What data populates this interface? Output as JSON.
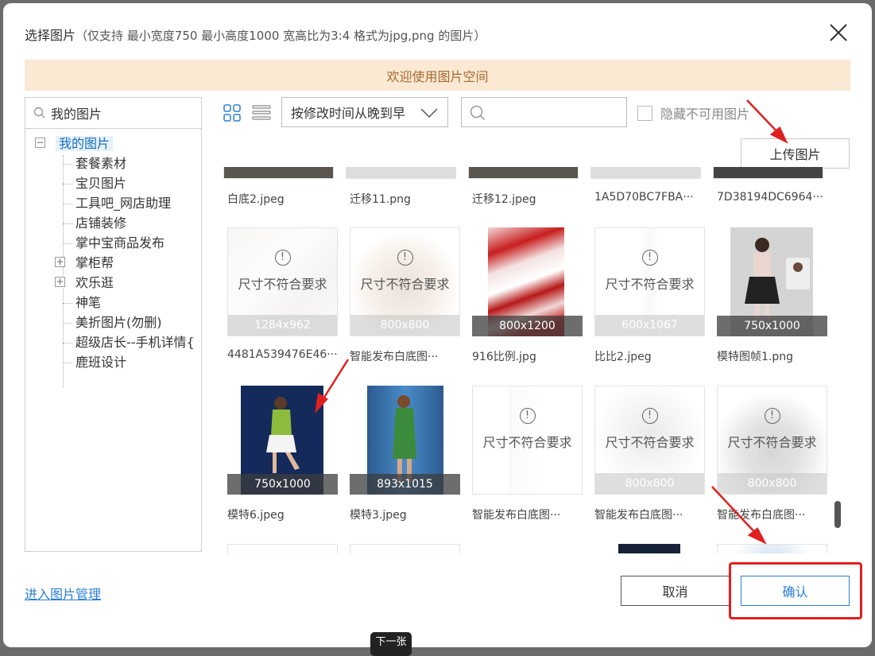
{
  "dialog": {
    "title": "选择图片",
    "hint": "（仅支持 最小宽度750 最小高度1000 宽高比为3:4 格式为jpg,png 的图片）",
    "close_icon": "close-icon",
    "banner": "欢迎使用图片空间"
  },
  "tree": {
    "search_value": "我的图片",
    "root": "我的图片",
    "children": [
      "套餐素材",
      "宝贝图片",
      "工具吧_网店助理",
      "店铺装修",
      "掌中宝商品发布",
      "掌柜帮",
      "欢乐逛",
      "神笔",
      "美折图片(勿删)",
      "超级店长--手机详情{",
      "鹿班设计"
    ]
  },
  "toolbar": {
    "sort_value": "按修改时间从晚到早",
    "search_placeholder": "",
    "hide_label": "隐藏不可用图片",
    "upload_label": "上传图片"
  },
  "grid": {
    "invalid_label": "尺寸不符合要求",
    "row0_names": [
      "白底2.jpeg",
      "迁移11.png",
      "迁移12.jpeg",
      "1A5D70BC7FBA···",
      "7D38194DC6964···"
    ],
    "row1": [
      {
        "name": "4481A539476E46···",
        "dim": "1284x962"
      },
      {
        "name": "智能发布白底图···",
        "dim": "800x800"
      },
      {
        "name": "916比例.jpg",
        "dim": "800x1200"
      },
      {
        "name": "比比2.jpeg",
        "dim": "600x1067"
      },
      {
        "name": "模特图帧1.png",
        "dim": "750x1000"
      }
    ],
    "row2": [
      {
        "name": "模特6.jpeg",
        "dim": "750x1000"
      },
      {
        "name": "模特3.jpeg",
        "dim": "893x1015"
      },
      {
        "name": "智能发布白底图···",
        "dim": ""
      },
      {
        "name": "智能发布白底图···",
        "dim": "800x800"
      },
      {
        "name": "智能发布白底图···",
        "dim": "800x800"
      }
    ]
  },
  "footer": {
    "manage_link": "进入图片管理",
    "cancel": "取消",
    "confirm": "确认",
    "tooltip": "下一张"
  },
  "colors": {
    "banner_bg": "#fce9d3",
    "banner_text": "#a36a2e",
    "link": "#2a7fd4",
    "annotation_red": "#e02020"
  }
}
